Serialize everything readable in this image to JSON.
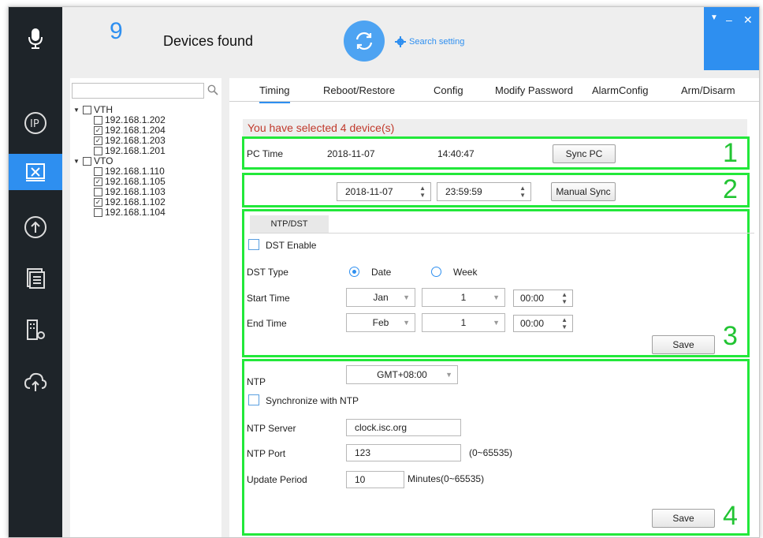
{
  "header": {
    "device_count": "9",
    "devices_found_label": "Devices found",
    "search_setting_label": "Search setting"
  },
  "tree": {
    "search_value": "",
    "groups": [
      {
        "label": "VTH",
        "checked": false,
        "items": [
          {
            "ip": "192.168.1.202",
            "checked": false
          },
          {
            "ip": "192.168.1.204",
            "checked": true
          },
          {
            "ip": "192.168.1.203",
            "checked": true
          },
          {
            "ip": "192.168.1.201",
            "checked": false
          }
        ]
      },
      {
        "label": "VTO",
        "checked": false,
        "items": [
          {
            "ip": "192.168.1.110",
            "checked": false
          },
          {
            "ip": "192.168.1.105",
            "checked": true
          },
          {
            "ip": "192.168.1.103",
            "checked": false
          },
          {
            "ip": "192.168.1.102",
            "checked": true
          },
          {
            "ip": "192.168.1.104",
            "checked": false
          }
        ]
      }
    ]
  },
  "tabs": [
    "Timing",
    "Reboot/Restore",
    "Config",
    "Modify Password",
    "AlarmConfig",
    "Arm/Disarm"
  ],
  "active_tab": "Timing",
  "selected_message": "You have selected 4 device(s)",
  "section1": {
    "number": "1",
    "pc_time_label": "PC Time",
    "date": "2018-11-07",
    "time": "14:40:47",
    "sync_pc_label": "Sync PC"
  },
  "section2": {
    "number": "2",
    "date_value": "2018-11-07",
    "time_value": "23:59:59",
    "manual_sync_label": "Manual Sync"
  },
  "section3": {
    "number": "3",
    "subtab_label": "NTP/DST",
    "dst_enable_label": "DST Enable",
    "dst_enable_checked": false,
    "dst_type_label": "DST Type",
    "date_option": "Date",
    "week_option": "Week",
    "dst_type_selected": "Date",
    "start_time_label": "Start Time",
    "start_month": "Jan",
    "start_day": "1",
    "start_time": "00:00",
    "end_time_label": "End Time",
    "end_month": "Feb",
    "end_day": "1",
    "end_time": "00:00",
    "save_label": "Save"
  },
  "section4": {
    "number": "4",
    "ntp_label": "NTP",
    "timezone": "GMT+08:00",
    "sync_ntp_label": "Synchronize with NTP",
    "sync_ntp_checked": false,
    "ntp_server_label": "NTP Server",
    "ntp_server_value": "clock.isc.org",
    "ntp_port_label": "NTP Port",
    "ntp_port_value": "123",
    "ntp_port_range": "(0~65535)",
    "update_period_label": "Update Period",
    "update_period_value": "10",
    "update_period_unit": "Minutes(0~65535)",
    "save_label": "Save"
  },
  "colors": {
    "accent": "#2e8ff0",
    "highlight_box": "#22e83a",
    "sidebar": "#1e2429",
    "warning_text": "#c0392b"
  }
}
